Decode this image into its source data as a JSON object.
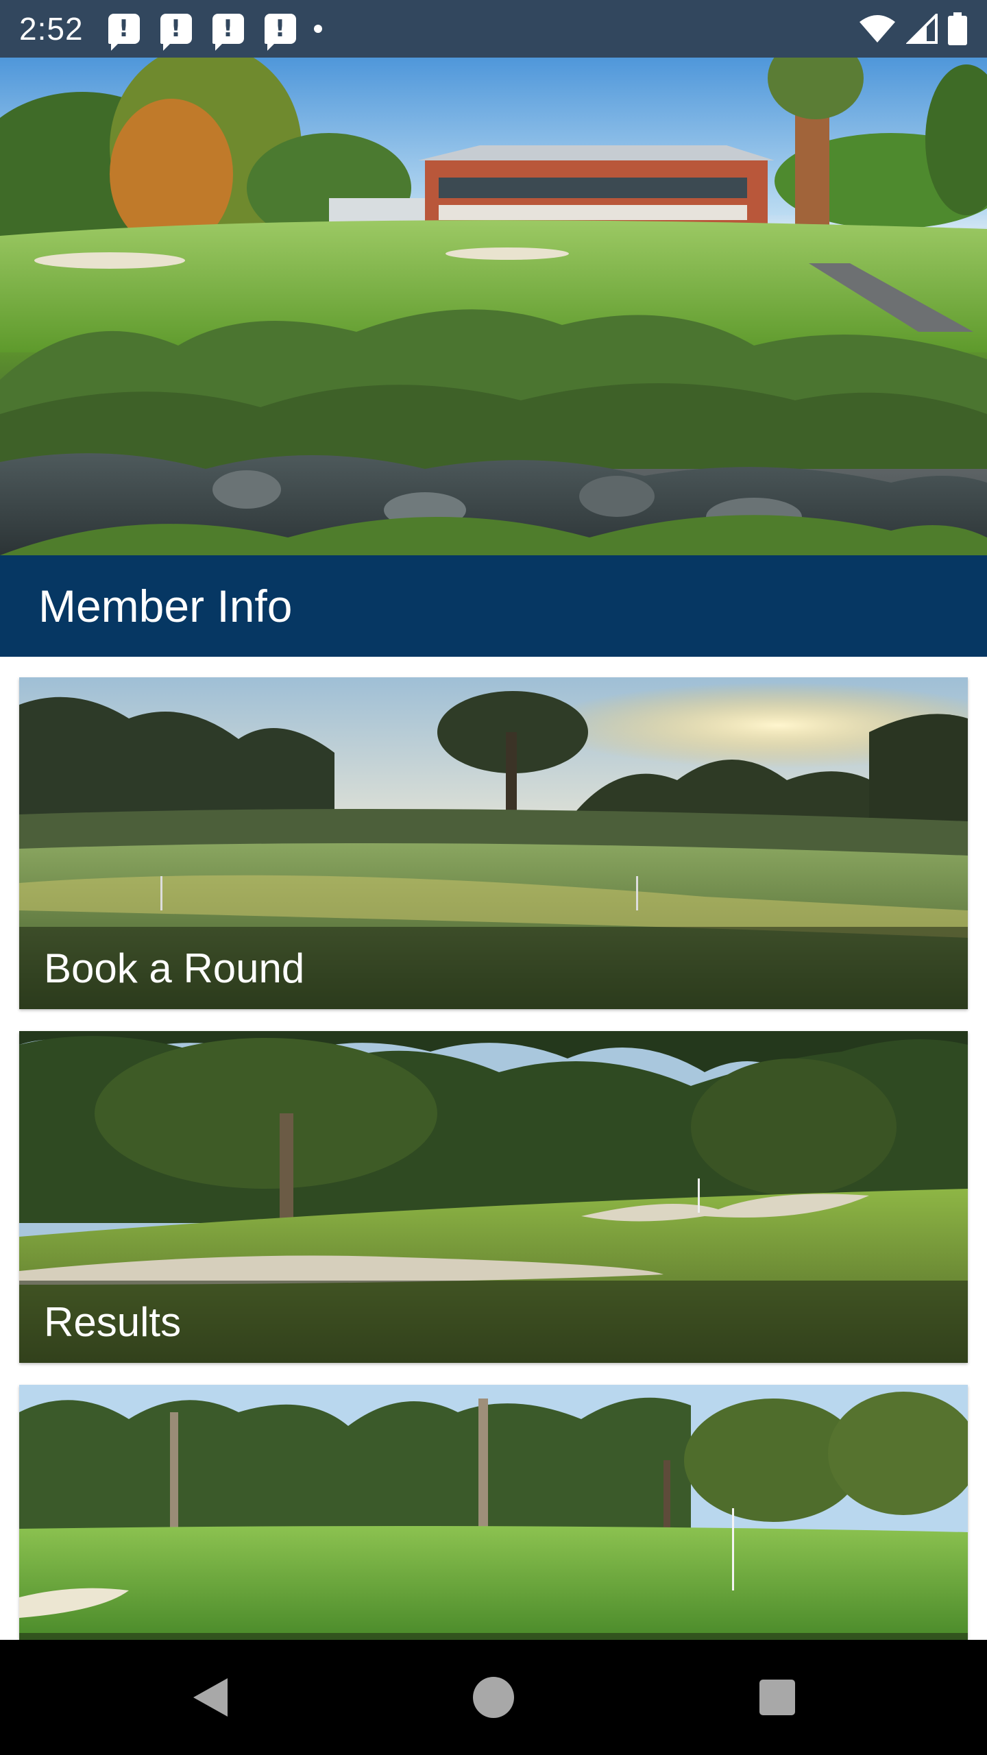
{
  "status_bar": {
    "time": "2:52",
    "notification_icons": [
      "alert-icon",
      "alert-icon",
      "alert-icon",
      "alert-icon"
    ],
    "notification_glyph": "!",
    "icons": [
      "wifi-icon",
      "cell-signal-icon",
      "battery-icon"
    ]
  },
  "hero": {
    "image": "golf-clubhouse-photo"
  },
  "section": {
    "title": "Member Info"
  },
  "cards": [
    {
      "label": "Book a Round",
      "image": "sunrise-fairway-photo"
    },
    {
      "label": "Results",
      "image": "green-with-bunkers-photo"
    },
    {
      "label": "",
      "image": "tree-lined-fairway-photo"
    }
  ],
  "nav_bar": {
    "buttons": [
      "back-icon",
      "home-icon",
      "recents-icon"
    ]
  },
  "colors": {
    "status_bar": "#32475e",
    "header": "#063763",
    "nav_bar": "#000000",
    "label_text": "#ffffff"
  }
}
